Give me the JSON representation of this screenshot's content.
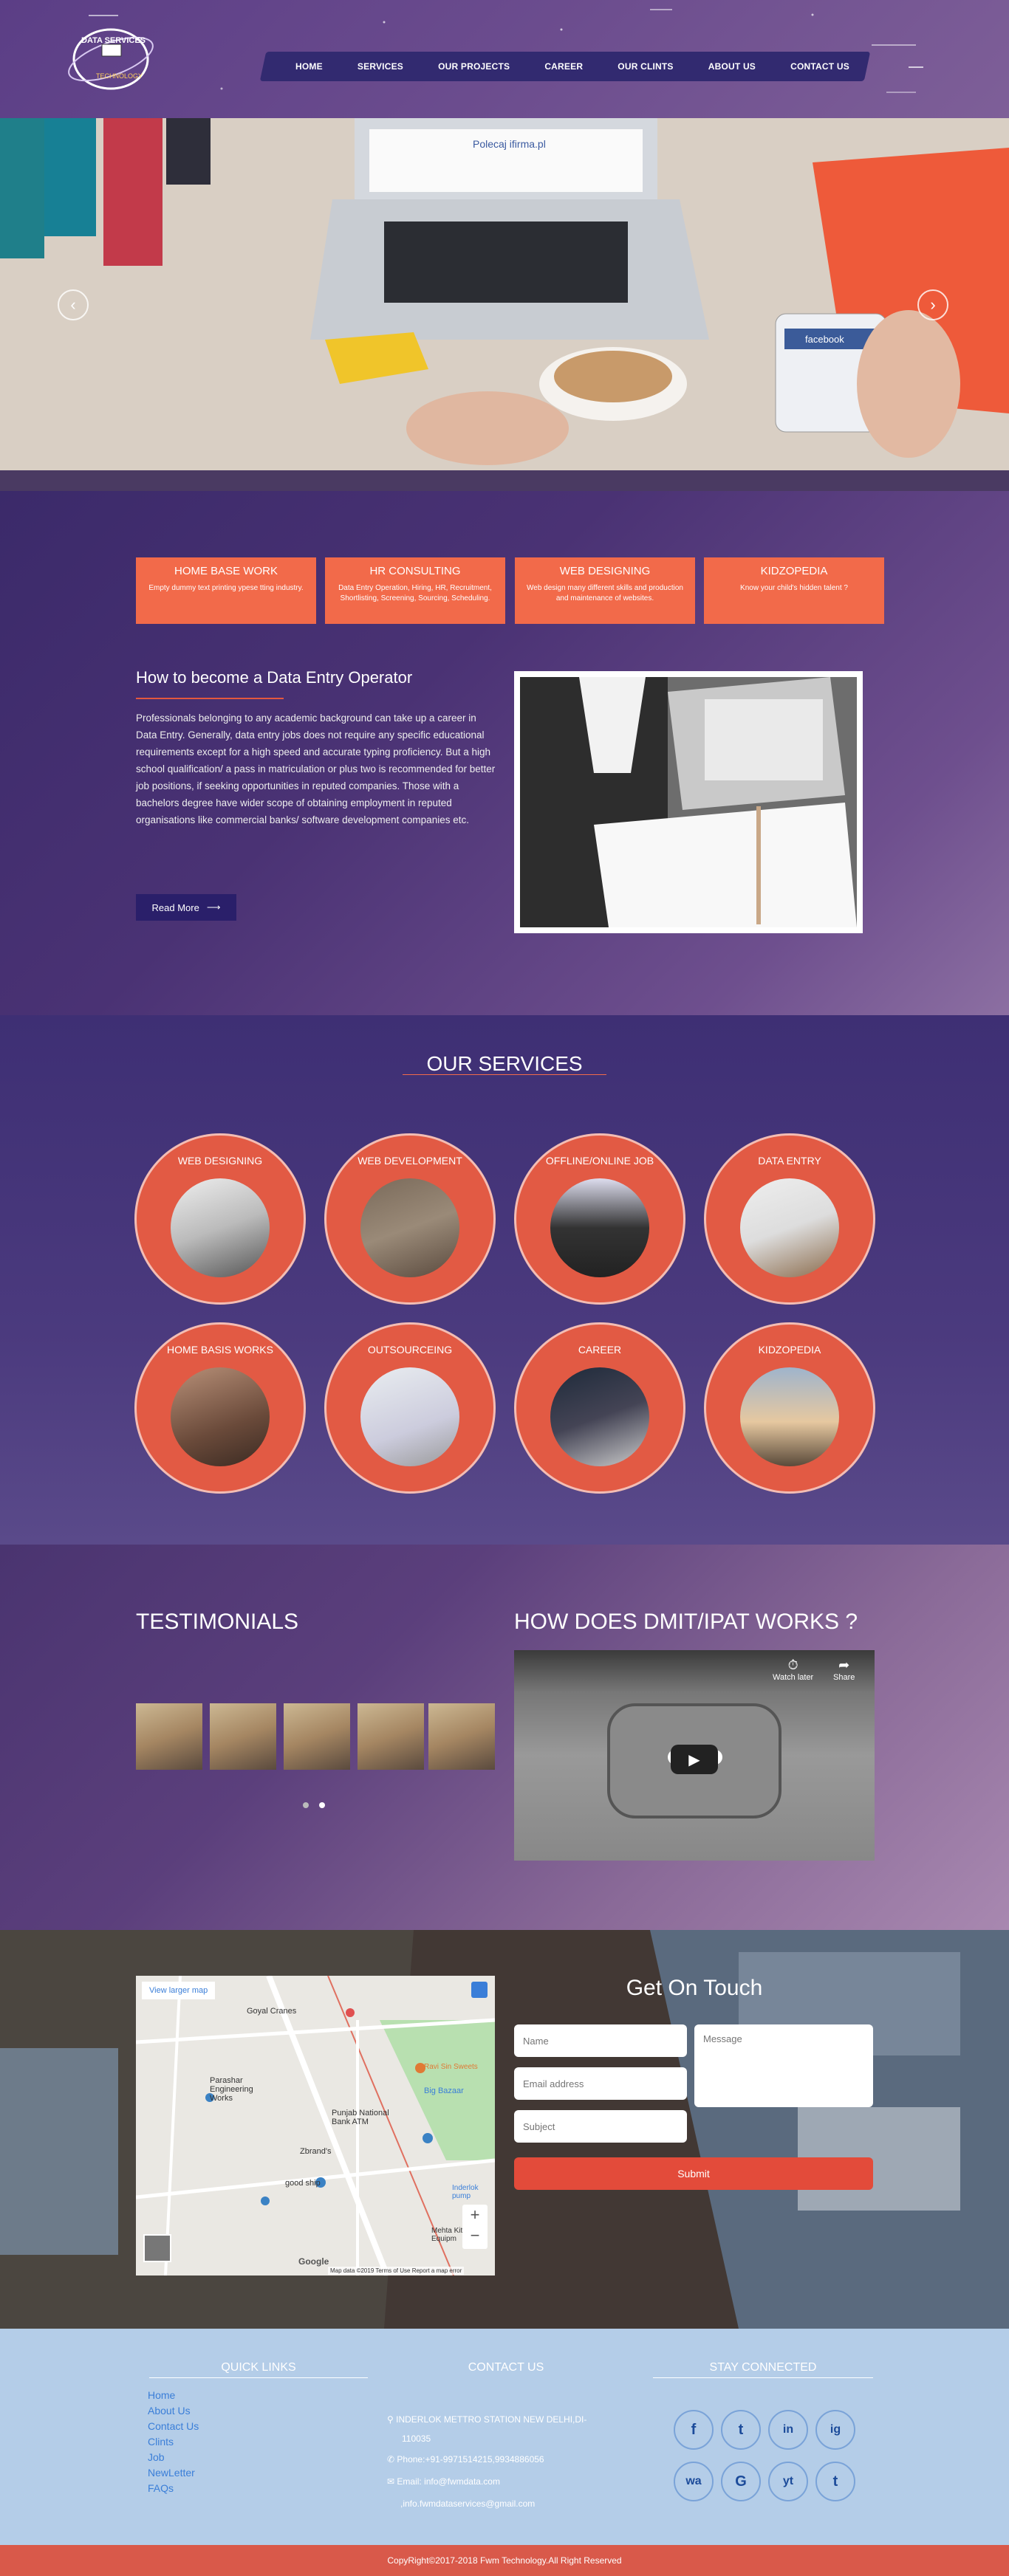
{
  "logo": {
    "text": "DATA SERVICES",
    "subtext": "TECHNOLOGY"
  },
  "nav": [
    {
      "label": "HOME"
    },
    {
      "label": "SERVICES"
    },
    {
      "label": "OUR PROJECTS"
    },
    {
      "label": "CAREER"
    },
    {
      "label": "OUR CLINTS"
    },
    {
      "label": "ABOUT US"
    },
    {
      "label": "CONTACT US"
    }
  ],
  "hero": {
    "prev": "‹",
    "next": "›"
  },
  "cards": [
    {
      "title": "HOME BASE WORK",
      "text": "Empty dummy text printing ypese tting industry."
    },
    {
      "title": "HR CONSULTING",
      "text": "Data Entry Operation, Hiring, HR, Recruitment, Shortlisting, Screening, Sourcing, Scheduling."
    },
    {
      "title": "WEB DESIGNING",
      "text": "Web design many different skills and production and maintenance of websites."
    },
    {
      "title": "KIDZOPEDIA",
      "text": "Know your child's hidden talent ?"
    }
  ],
  "intro": {
    "title": "How to become a Data Entry Operator",
    "text": "Professionals belonging to any academic background can take up a career in Data Entry. Generally, data entry jobs does not require any specific educational requirements except for a high speed and accurate typing proficiency. But a high school qualification/ a pass in matriculation or plus two is recommended for better job positions, if seeking opportunities in reputed companies. Those with a bachelors degree have wider scope of obtaining employment in reputed organisations like commercial banks/ software development companies etc.",
    "button": "Read More"
  },
  "services": {
    "title": "OUR SERVICES",
    "items": [
      {
        "label": "WEB DESIGNING"
      },
      {
        "label": "WEB DEVELOPMENT"
      },
      {
        "label": "OFFLINE/ONLINE JOB"
      },
      {
        "label": "DATA ENTRY"
      },
      {
        "label": "HOME BASIS WORKS"
      },
      {
        "label": "OUTSOURCEING"
      },
      {
        "label": "CAREER"
      },
      {
        "label": "KIDZOPEDIA"
      }
    ]
  },
  "testimonials": {
    "title": "TESTIMONIALS"
  },
  "dmit": {
    "title": "HOW DOES DMIT/IPAT WORKS ?",
    "watch_later": "Watch later",
    "share": "Share"
  },
  "map": {
    "view_larger": "View larger map",
    "labels": {
      "goyal": "Goyal Cranes",
      "parashar": "Parashar Engineering Works",
      "punjab": "Punjab National Bank ATM",
      "zbrand": "Zbrand's",
      "goodship": "good ship",
      "bigbazaar": "Big Bazaar",
      "mehta": "Mehta Kit Equipm",
      "inderlok": "Inderlok pump",
      "ravi": "Ravi Sin Sweets"
    },
    "zoom_in": "+",
    "zoom_out": "−",
    "attribution": "Map data ©2019   Terms of Use   Report a map error",
    "google": "Google"
  },
  "contact": {
    "title": "Get On Touch",
    "name_ph": "Name",
    "email_ph": "Email address",
    "subject_ph": "Subject",
    "message_ph": "Message",
    "submit": "Submit"
  },
  "footer": {
    "quick_title": "QUICK LINKS",
    "links": [
      "Home",
      "About Us",
      "Contact Us",
      "Clints",
      "Job",
      "NewLetter",
      "FAQs"
    ],
    "contact_title": "CONTACT US",
    "address1": "INDERLOK METTRO STATION NEW DELHI,DI-",
    "address2": "110035",
    "phone": "Phone:+91-9971514215,9934886056",
    "email1": "Email: info@fwmdata.com",
    "email2": ",info.fwmdataservices@gmail.com",
    "stay_title": "STAY CONNECTED",
    "social": [
      "f",
      "t",
      "in",
      "ig",
      "wa",
      "G",
      "yt",
      "t"
    ]
  },
  "copyright": "CopyRight©2017-2018 Fwm Technology.All Right Reserved"
}
